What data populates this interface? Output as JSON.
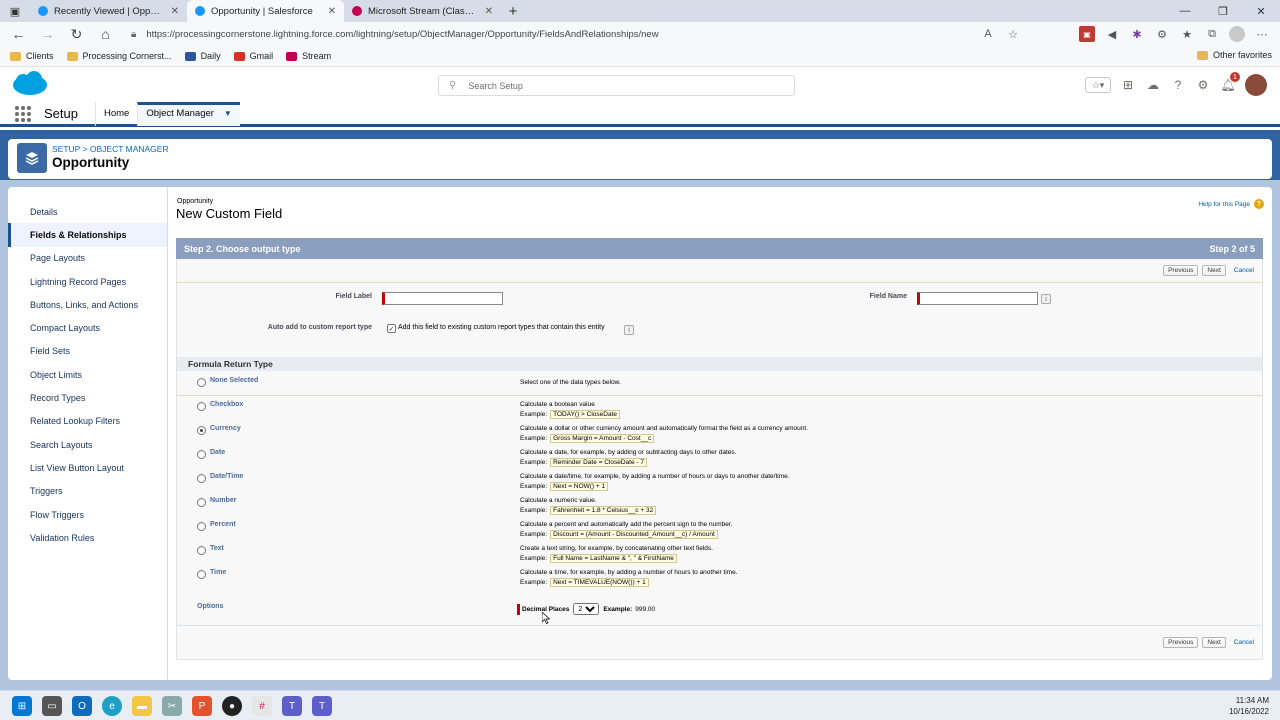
{
  "browser": {
    "tabs": [
      {
        "title": "Recently Viewed | Opportunities",
        "active": false,
        "color": "#1b96ff"
      },
      {
        "title": "Opportunity | Salesforce",
        "active": true,
        "color": "#1b96ff"
      },
      {
        "title": "Microsoft Stream (Classic)",
        "active": false,
        "color": "#c30052"
      }
    ],
    "url": "https://processingcornerstone.lightning.force.com/lightning/setup/ObjectManager/Opportunity/FieldsAndRelationships/new",
    "bookmarks": [
      {
        "label": "Clients",
        "color": "#e8b84a"
      },
      {
        "label": "Processing Cornerst...",
        "color": "#e8b84a"
      },
      {
        "label": "Daily",
        "color": "#2b579a"
      },
      {
        "label": "Gmail",
        "color": "#d93025"
      },
      {
        "label": "Stream",
        "color": "#c30052"
      }
    ],
    "other_favorites": "Other favorites"
  },
  "sf": {
    "search_placeholder": "Search Setup",
    "app_name": "Setup",
    "nav_tabs": {
      "home": "Home",
      "object_manager": "Object Manager"
    },
    "notification_count": "1",
    "breadcrumb": "SETUP > OBJECT MANAGER",
    "object_title": "Opportunity"
  },
  "sidebar": {
    "items": [
      {
        "label": "Details",
        "active": false
      },
      {
        "label": "Fields & Relationships",
        "active": true
      },
      {
        "label": "Page Layouts",
        "active": false
      },
      {
        "label": "Lightning Record Pages",
        "active": false
      },
      {
        "label": "Buttons, Links, and Actions",
        "active": false
      },
      {
        "label": "Compact Layouts",
        "active": false
      },
      {
        "label": "Field Sets",
        "active": false
      },
      {
        "label": "Object Limits",
        "active": false
      },
      {
        "label": "Record Types",
        "active": false
      },
      {
        "label": "Related Lookup Filters",
        "active": false
      },
      {
        "label": "Search Layouts",
        "active": false
      },
      {
        "label": "List View Button Layout",
        "active": false
      },
      {
        "label": "Triggers",
        "active": false
      },
      {
        "label": "Flow Triggers",
        "active": false
      },
      {
        "label": "Validation Rules",
        "active": false
      }
    ]
  },
  "page": {
    "object_tag": "Opportunity",
    "title": "New Custom Field",
    "help_link": "Help for this Page",
    "step_label": "Step 2. Choose output type",
    "step_count": "Step 2 of 5",
    "buttons": {
      "previous": "Previous",
      "next": "Next",
      "cancel": "Cancel"
    },
    "field_label_label": "Field Label",
    "field_label_value": "",
    "field_name_label": "Field Name",
    "field_name_value": "",
    "auto_add_label": "Auto add to custom report type",
    "auto_add_text": "Add this field to existing custom report types that contain this entity",
    "auto_add_checked": true,
    "formula_header": "Formula Return Type",
    "none_selected": "None Selected",
    "none_desc": "Select one of the data types below.",
    "example_prefix": "Example:",
    "types": [
      {
        "label": "Checkbox",
        "desc": "Calculate a boolean value",
        "example": "TODAY() > CloseDate",
        "selected": false
      },
      {
        "label": "Currency",
        "desc": "Calculate a dollar or other currency amount and automatically format the field as a currency amount.",
        "example": "Gross Margin = Amount - Cost__c",
        "selected": true
      },
      {
        "label": "Date",
        "desc": "Calculate a date, for example, by adding or subtracting days to other dates.",
        "example": "Reminder Date = CloseDate - 7",
        "selected": false
      },
      {
        "label": "Date/Time",
        "desc": "Calculate a date/time, for example, by adding a number of hours or days to another date/time.",
        "example": "Next = NOW() + 1",
        "selected": false
      },
      {
        "label": "Number",
        "desc": "Calculate a numeric value.",
        "example": "Fahrenheit = 1.8 * Celsius__c + 32",
        "selected": false
      },
      {
        "label": "Percent",
        "desc": "Calculate a percent and automatically add the percent sign to the number.",
        "example": "Discount = (Amount - Discounted_Amount__c) / Amount",
        "selected": false
      },
      {
        "label": "Text",
        "desc": "Create a text string, for example, by concatenating other text fields.",
        "example": "Full Name = LastName & \", \" & FirstName",
        "selected": false
      },
      {
        "label": "Time",
        "desc": "Calculate a time, for example, by adding a number of hours to another time.",
        "example": "Next = TIMEVALUE(NOW()) + 1",
        "selected": false
      }
    ],
    "options_label": "Options",
    "decimal_label": "Decimal Places",
    "decimal_value": "2",
    "decimal_example_label": "Example:",
    "decimal_example": "999.00"
  },
  "taskbar": {
    "time": "11:34 AM",
    "date": "10/16/2022"
  }
}
